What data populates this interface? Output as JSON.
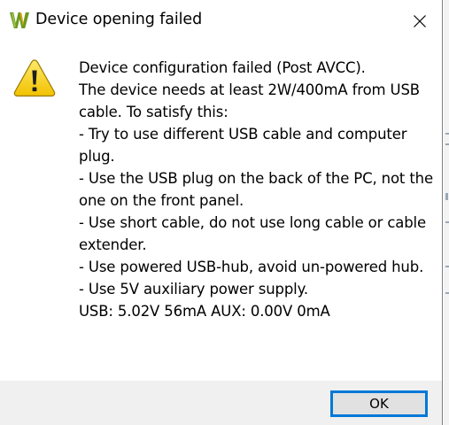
{
  "window": {
    "title": "Device opening failed",
    "app_icon": "waveforms-w-logo-icon",
    "close_icon": "close-icon"
  },
  "message": {
    "icon": "warning-icon",
    "lines": [
      "Device configuration failed (Post AVCC).",
      "The device needs at least 2W/400mA from USB",
      "cable. To satisfy this:",
      "- Try to use different USB cable and computer",
      "plug.",
      "- Use the USB plug on the back of the PC, not the",
      "one on the front panel.",
      "- Use short cable, do not use long cable or cable",
      "extender.",
      "- Use powered USB-hub, avoid un-powered hub.",
      "- Use 5V auxiliary power supply.",
      "USB: 5.02V 56mA AUX: 0.00V 0mA"
    ]
  },
  "footer": {
    "ok_label": "OK"
  },
  "colors": {
    "accent": "#0078d7",
    "footer_bg": "#f0f0f0",
    "button_bg": "#e1e1e1",
    "warning_yellow": "#f7d000",
    "logo_green": "#6a9a1f"
  }
}
